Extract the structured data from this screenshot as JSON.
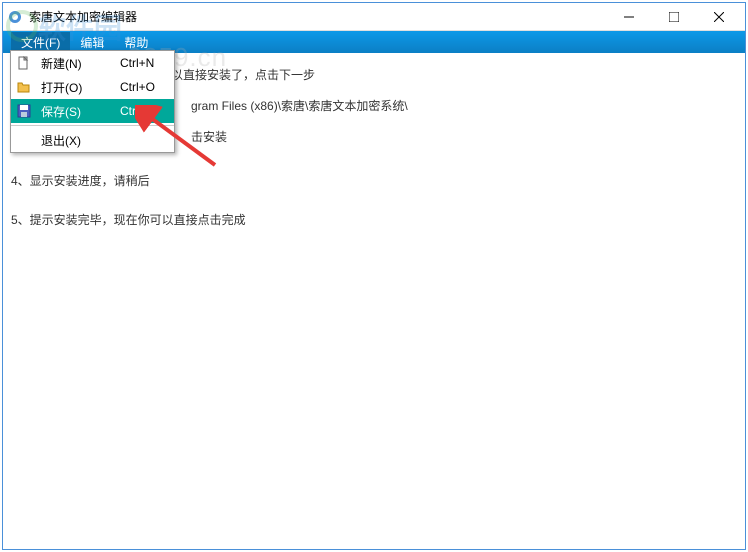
{
  "window": {
    "title": "索唐文本加密编辑器"
  },
  "menubar": {
    "file": "文件(F)",
    "edit": "编辑",
    "help": "帮助"
  },
  "dropdown": {
    "new": {
      "label": "新建(N)",
      "shortcut": "Ctrl+N"
    },
    "open": {
      "label": "打开(O)",
      "shortcut": "Ctrl+O"
    },
    "save": {
      "label": "保存(S)",
      "shortcut": "Ctrl+S"
    },
    "exit": {
      "label": "退出(X)",
      "shortcut": ""
    }
  },
  "content": {
    "l1": "以直接安装了，点击下一步",
    "l2": "gram Files (x86)\\索唐\\索唐文本加密系统\\",
    "l3": "击安装",
    "l4": "4、显示安装进度，请稍后",
    "l5": "5、提示安装完毕，现在你可以直接点击完成"
  },
  "watermark": {
    "brand": "软件园",
    "url": "www.pc0359.cn"
  }
}
